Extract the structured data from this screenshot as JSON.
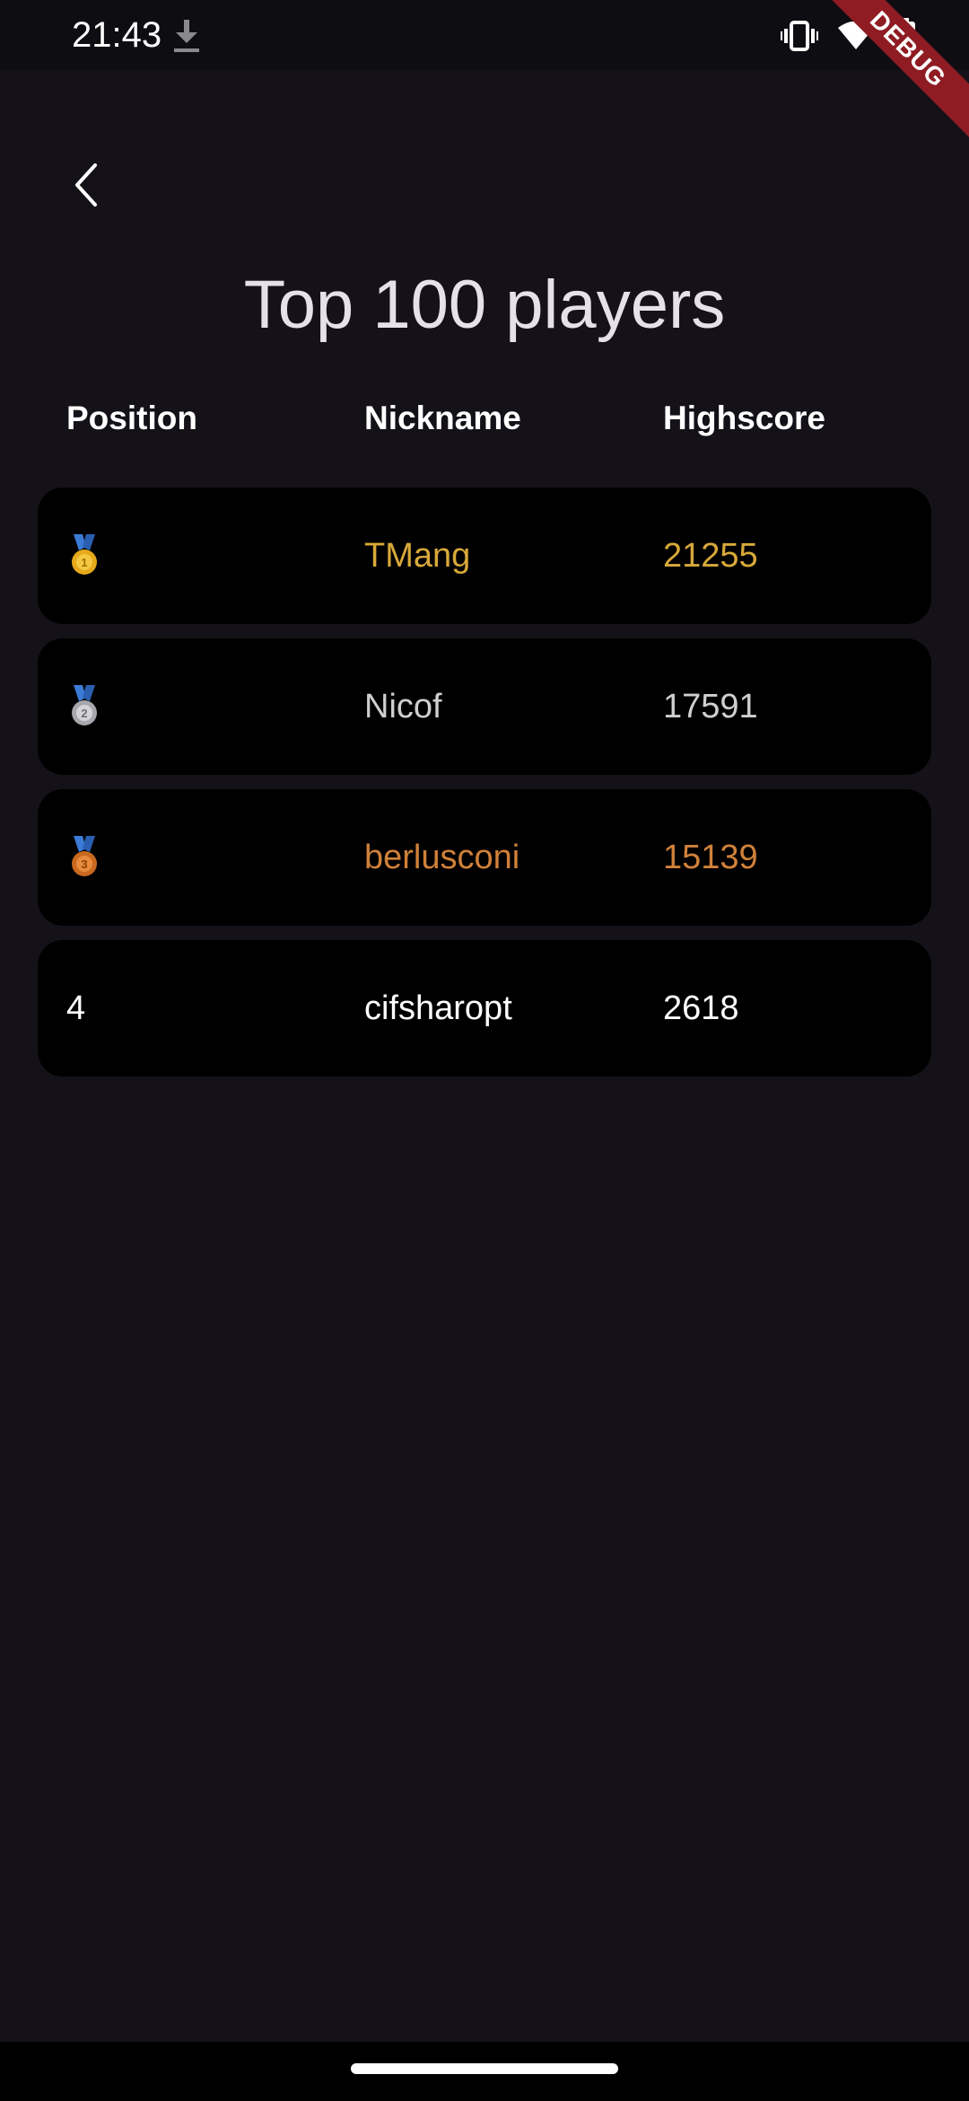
{
  "status_bar": {
    "time": "21:43",
    "icons": [
      "download-icon",
      "vibrate-icon",
      "wifi-icon",
      "battery-charging-icon"
    ]
  },
  "debug_banner": {
    "label": "DEBUG",
    "color": "#8e1c22"
  },
  "header": {
    "back_icon": "chevron-left-icon",
    "title": "Top 100 players"
  },
  "table": {
    "columns": [
      "Position",
      "Nickname",
      "Highscore"
    ],
    "rows": [
      {
        "position": "1",
        "medal": "gold-medal-icon",
        "nickname": "TMang",
        "highscore": "21255",
        "color": "#d8a93a"
      },
      {
        "position": "2",
        "medal": "silver-medal-icon",
        "nickname": "Nicof",
        "highscore": "17591",
        "color": "#cfcfcf"
      },
      {
        "position": "3",
        "medal": "bronze-medal-icon",
        "nickname": "berlusconi",
        "highscore": "15139",
        "color": "#d0813a"
      },
      {
        "position": "4",
        "medal": "",
        "nickname": "cifsharopt",
        "highscore": "2618",
        "color": "#ffffff"
      }
    ]
  },
  "colors": {
    "background": "#141218",
    "row_background": "#000000",
    "title": "#e6e0e9",
    "gold": "#d8a93a",
    "silver": "#cfcfcf",
    "bronze": "#d0813a"
  }
}
